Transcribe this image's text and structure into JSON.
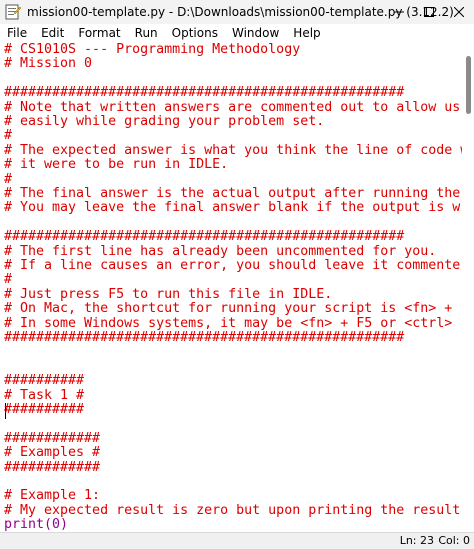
{
  "window": {
    "title": "mission00-template.py - D:\\Downloads\\mission00-template.py (3.12.2)"
  },
  "menu": [
    "File",
    "Edit",
    "Format",
    "Run",
    "Options",
    "Window",
    "Help"
  ],
  "editor": {
    "lines": [
      {
        "text": "# CS1010S --- Programming Methodology",
        "kind": "comment"
      },
      {
        "text": "# Mission 0",
        "kind": "comment"
      },
      {
        "text": "",
        "kind": "comment"
      },
      {
        "text": "##################################################",
        "kind": "comment"
      },
      {
        "text": "# Note that written answers are commented out to allow us",
        "kind": "comment"
      },
      {
        "text": "# easily while grading your problem set.",
        "kind": "comment"
      },
      {
        "text": "#",
        "kind": "comment"
      },
      {
        "text": "# The expected answer is what you think the line of code w",
        "kind": "comment"
      },
      {
        "text": "# it were to be run in IDLE.",
        "kind": "comment"
      },
      {
        "text": "#",
        "kind": "comment"
      },
      {
        "text": "# The final answer is the actual output after running the",
        "kind": "comment"
      },
      {
        "text": "# You may leave the final answer blank if the output is w",
        "kind": "comment"
      },
      {
        "text": "",
        "kind": "comment"
      },
      {
        "text": "##################################################",
        "kind": "comment"
      },
      {
        "text": "# The first line has already been uncommented for you.",
        "kind": "comment"
      },
      {
        "text": "# If a line causes an error, you should leave it commente",
        "kind": "comment"
      },
      {
        "text": "#",
        "kind": "comment"
      },
      {
        "text": "# Just press F5 to run this file in IDLE.",
        "kind": "comment"
      },
      {
        "text": "# On Mac, the shortcut for running your script is <fn> +",
        "kind": "comment"
      },
      {
        "text": "# In some Windows systems, it may be <fn> + F5 or <ctrl>",
        "kind": "comment"
      },
      {
        "text": "##################################################",
        "kind": "comment"
      },
      {
        "text": "",
        "kind": "comment"
      },
      {
        "text": "",
        "kind": "comment"
      },
      {
        "text": "##########",
        "kind": "comment"
      },
      {
        "text": "# Task 1 #",
        "kind": "comment"
      },
      {
        "text": "##########",
        "kind": "comment"
      },
      {
        "text": "",
        "kind": "comment"
      },
      {
        "text": "############",
        "kind": "comment"
      },
      {
        "text": "# Examples #",
        "kind": "comment"
      },
      {
        "text": "############",
        "kind": "comment"
      },
      {
        "text": "",
        "kind": "comment"
      },
      {
        "text": "# Example 1:",
        "kind": "comment"
      },
      {
        "text": "# My expected result is zero but upon printing the result",
        "kind": "comment"
      },
      {
        "text": "print(0)",
        "kind": "builtin"
      }
    ]
  },
  "status": {
    "line": "Ln: 23",
    "col": "Col: 0"
  },
  "colors": {
    "comment": "#dd0000",
    "builtin": "#900090",
    "background": "#ffffff"
  }
}
